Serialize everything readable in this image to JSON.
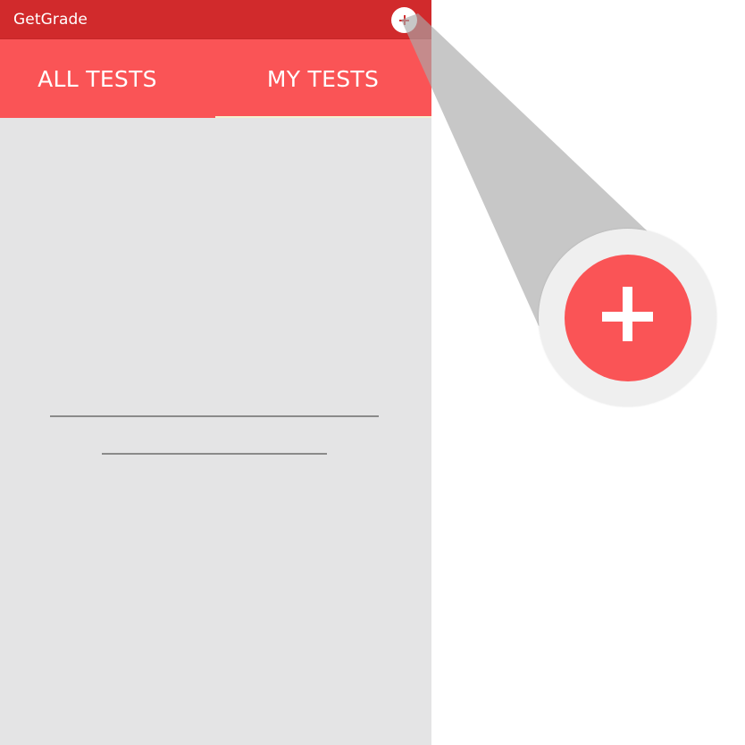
{
  "app": {
    "title": "GetGrade",
    "add_icon": "plus-icon"
  },
  "tabs": [
    {
      "label": "ALL TESTS",
      "selected": false
    },
    {
      "label": "MY TESTS",
      "selected": true
    }
  ],
  "colors": {
    "app_bar": "#d12a2c",
    "tab_bar": "#fa5456",
    "content_background": "#e4e4e5",
    "fab": "#fa5456",
    "tab_indicator": "#f4f1d0"
  },
  "callout": {
    "icon": "plus-icon"
  }
}
